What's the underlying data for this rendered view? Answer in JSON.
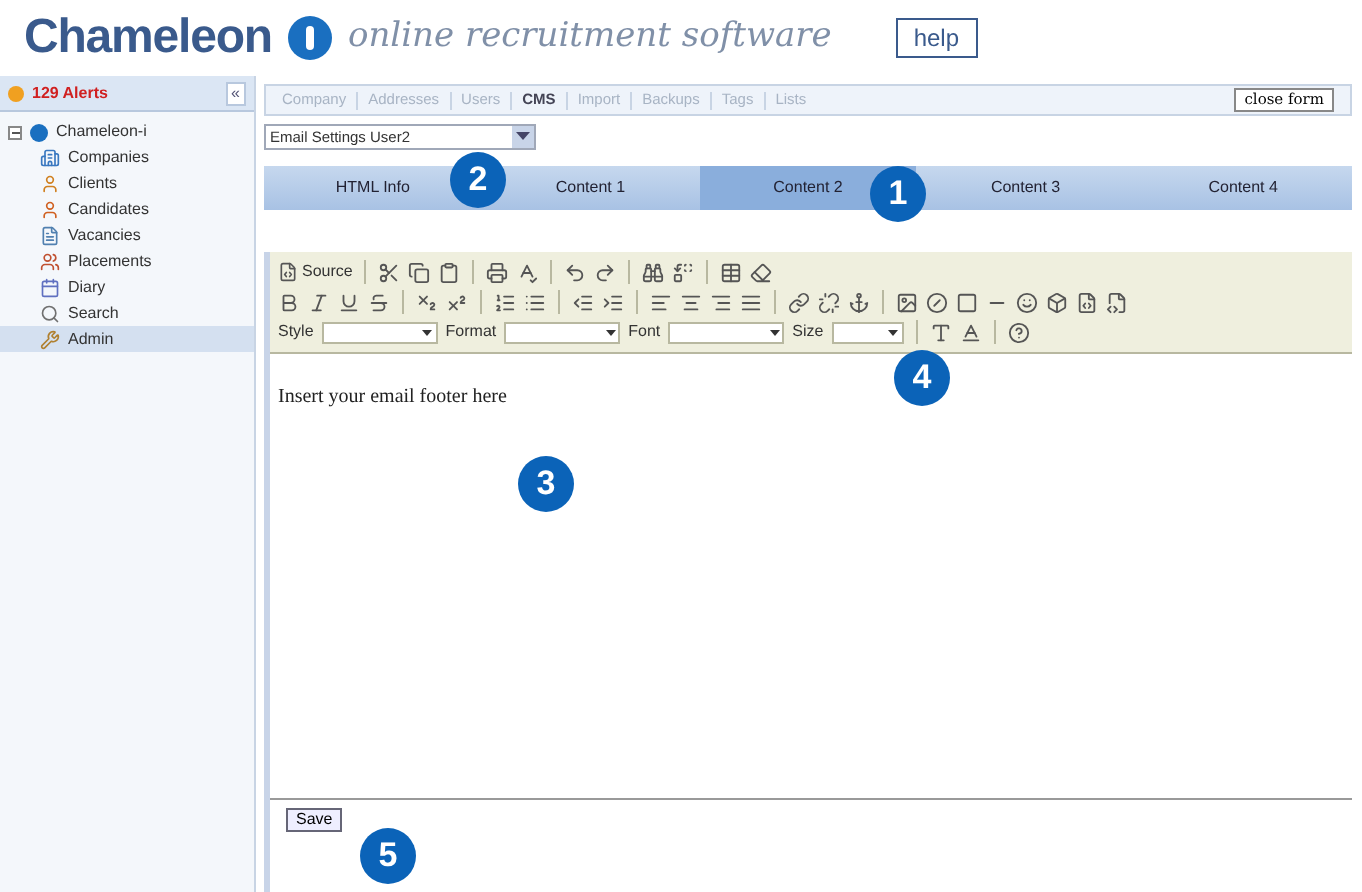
{
  "header": {
    "brand": "Chameleon",
    "tagline": "online recruitment software",
    "help": "help"
  },
  "sidebar": {
    "alerts": "129 Alerts",
    "collapse": "«",
    "tree": [
      {
        "label": "Chameleon-i",
        "expanded": true,
        "selected": false,
        "children": [
          {
            "label": "Companies",
            "selected": false
          },
          {
            "label": "Clients",
            "selected": false
          },
          {
            "label": "Candidates",
            "selected": false
          },
          {
            "label": "Vacancies",
            "selected": false
          },
          {
            "label": "Placements",
            "selected": false
          },
          {
            "label": "Diary",
            "selected": false
          },
          {
            "label": "Search",
            "selected": false
          },
          {
            "label": "Admin",
            "selected": true
          }
        ]
      }
    ]
  },
  "nav_tabs": [
    {
      "label": "Company",
      "selected": false
    },
    {
      "label": "Addresses",
      "selected": false
    },
    {
      "label": "Users",
      "selected": false
    },
    {
      "label": "CMS",
      "selected": true
    },
    {
      "label": "Import",
      "selected": false
    },
    {
      "label": "Backups",
      "selected": false
    },
    {
      "label": "Tags",
      "selected": false
    },
    {
      "label": "Lists",
      "selected": false
    }
  ],
  "close_form": "close form",
  "settings_select": {
    "value": "Email Settings User2"
  },
  "content_tabs": [
    {
      "label": "HTML Info",
      "selected": false
    },
    {
      "label": "Content 1",
      "selected": false
    },
    {
      "label": "Content 2",
      "selected": true
    },
    {
      "label": "Content 3",
      "selected": false
    },
    {
      "label": "Content 4",
      "selected": false
    }
  ],
  "editor": {
    "source": "Source",
    "combos": [
      "Style",
      "Format",
      "Font",
      "Size"
    ],
    "body": "Insert your email footer here"
  },
  "save": "Save",
  "callouts": [
    "1",
    "2",
    "3",
    "4",
    "5"
  ]
}
